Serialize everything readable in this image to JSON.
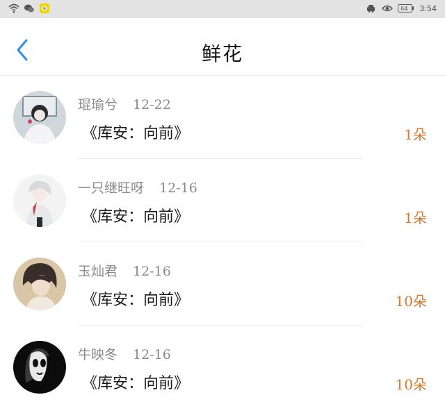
{
  "status_bar": {
    "time": "3:54",
    "battery": "64",
    "icons": [
      "wifi-icon",
      "wechat-icon",
      "app-icon",
      "car-icon",
      "eye-icon",
      "battery-icon"
    ]
  },
  "header": {
    "title": "鲜花",
    "back_icon": "chevron-left-icon"
  },
  "colors": {
    "accent": "#2d8ff0",
    "amount": "#d9782e",
    "meta": "#8a8a8a",
    "status_bar": "#e3e3e3"
  },
  "items": [
    {
      "name": "琨瑜兮",
      "date": "12-22",
      "book": "《库安：向前》",
      "amount": "1朵"
    },
    {
      "name": "一只继旺呀",
      "date": "12-16",
      "book": "《库安：向前》",
      "amount": "1朵"
    },
    {
      "name": "玉灿君",
      "date": "12-16",
      "book": "《库安：向前》",
      "amount": "10朵"
    },
    {
      "name": "牛映冬",
      "date": "12-16",
      "book": "《库安：向前》",
      "amount": "10朵"
    }
  ]
}
